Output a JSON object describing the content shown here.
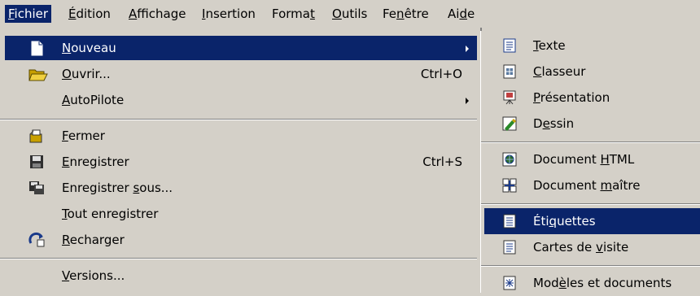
{
  "menubar": {
    "items": [
      {
        "pre": "",
        "u": "F",
        "post": "ichier",
        "active": true
      },
      {
        "pre": "",
        "u": "É",
        "post": "dition"
      },
      {
        "pre": "",
        "u": "A",
        "post": "ffichage"
      },
      {
        "pre": "",
        "u": "I",
        "post": "nsertion"
      },
      {
        "pre": "Forma",
        "u": "t",
        "post": ""
      },
      {
        "pre": "",
        "u": "O",
        "post": "utils"
      },
      {
        "pre": "Fe",
        "u": "n",
        "post": "être"
      },
      {
        "pre": "Ai",
        "u": "d",
        "post": "e"
      }
    ]
  },
  "file_menu": {
    "items": [
      {
        "pre": "",
        "u": "N",
        "post": "ouveau",
        "icon": "new-document-icon",
        "submenu": true
      },
      {
        "pre": "",
        "u": "O",
        "post": "uvrir...",
        "icon": "open-folder-icon",
        "shortcut": "Ctrl+O"
      },
      {
        "pre": "",
        "u": "A",
        "post": "utoPilote",
        "submenu": true
      },
      {
        "pre": "",
        "u": "F",
        "post": "ermer",
        "icon": "close-document-icon"
      },
      {
        "pre": "",
        "u": "E",
        "post": "nregistrer",
        "icon": "save-icon",
        "shortcut": "Ctrl+S"
      },
      {
        "pre": "Enregistrer ",
        "u": "s",
        "post": "ous...",
        "icon": "save-as-icon"
      },
      {
        "pre": "",
        "u": "T",
        "post": "out enregistrer"
      },
      {
        "pre": "",
        "u": "R",
        "post": "echarger",
        "icon": "reload-icon"
      },
      {
        "pre": "",
        "u": "V",
        "post": "ersions..."
      }
    ]
  },
  "new_submenu": {
    "items": [
      {
        "pre": "",
        "u": "T",
        "post": "exte",
        "icon": "text-document-icon"
      },
      {
        "pre": "",
        "u": "C",
        "post": "lasseur",
        "icon": "spreadsheet-icon"
      },
      {
        "pre": "",
        "u": "P",
        "post": "résentation",
        "icon": "presentation-icon"
      },
      {
        "pre": "D",
        "u": "e",
        "post": "ssin",
        "icon": "drawing-icon"
      },
      {
        "pre": "Document ",
        "u": "H",
        "post": "TML",
        "icon": "html-document-icon"
      },
      {
        "pre": "Document ",
        "u": "m",
        "post": "aître",
        "icon": "master-document-icon"
      },
      {
        "pre": "Éti",
        "u": "q",
        "post": "uettes",
        "icon": "labels-icon",
        "active": true
      },
      {
        "pre": "Cartes de ",
        "u": "v",
        "post": "isite",
        "icon": "business-cards-icon"
      },
      {
        "pre": "Mod",
        "u": "è",
        "post": "les et documents",
        "icon": "templates-icon"
      }
    ]
  },
  "colors": {
    "menu_bg": "#d4d0c8",
    "highlight": "#0a246a",
    "highlight_text": "#ffffff"
  }
}
